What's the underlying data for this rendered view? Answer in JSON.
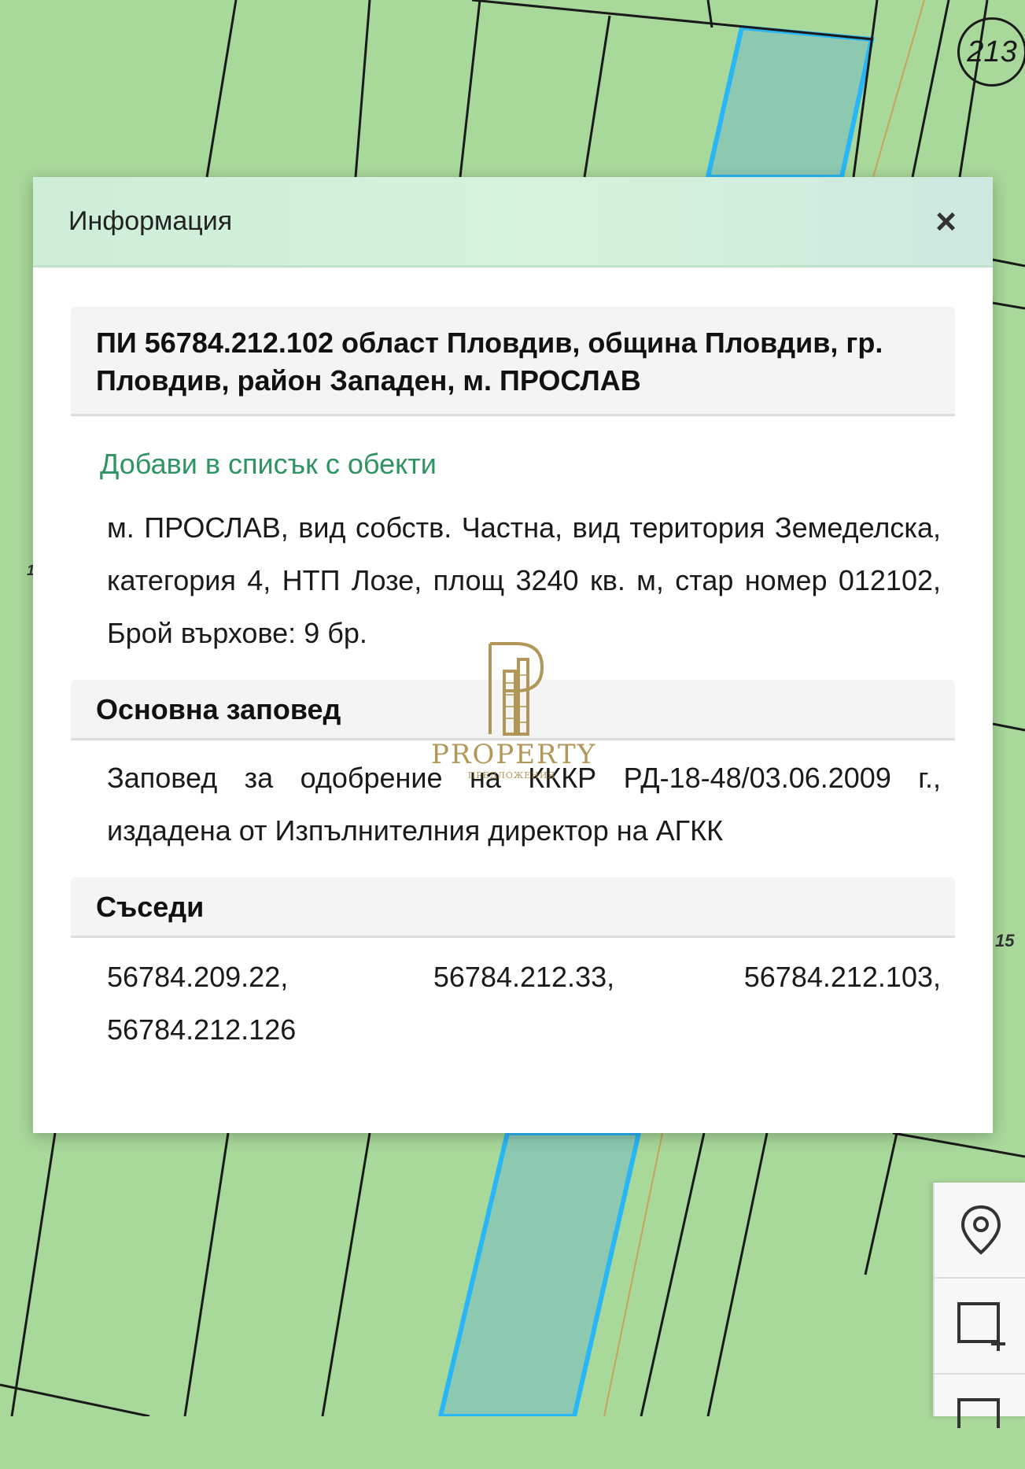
{
  "map": {
    "parcel_number": "213",
    "side_number": "15",
    "left_edge_number": "1"
  },
  "dialog": {
    "title": "Информация",
    "close_label": "×",
    "property_header": "ПИ 56784.212.102 област Пловдив, община Пловдив, гр. Пловдив, район Западен, м. ПРОСЛАВ",
    "add_to_list": "Добави в списък с обекти",
    "description": "м. ПРОСЛАВ, вид собств. Частна, вид територия Земеделска, категория 4, НТП Лозе, площ 3240 кв. м, стар номер 012102, Брой върхове: 9 бр.",
    "order_heading": "Основна заповед",
    "order_text": "Заповед за одобрение на КККР РД-18-48/03.06.2009 г., издадена от Изпълнителния директор на АГКК",
    "neighbors_heading": "Съседи",
    "neighbors": [
      "56784.209.22,",
      "56784.212.33,",
      "56784.212.103,",
      "56784.212.126"
    ]
  },
  "watermark": {
    "brand": "PROPERTY",
    "tagline": "ПРЕДЛОЖЕНИЯ"
  },
  "tools": [
    "location-pin-icon",
    "draw-rectangle-icon",
    "layers-icon"
  ],
  "colors": {
    "map_green": "#a8d89a",
    "highlight_parcel": "#29b6f6",
    "link_green": "#2e9462",
    "watermark_gold": "#a5863c"
  }
}
